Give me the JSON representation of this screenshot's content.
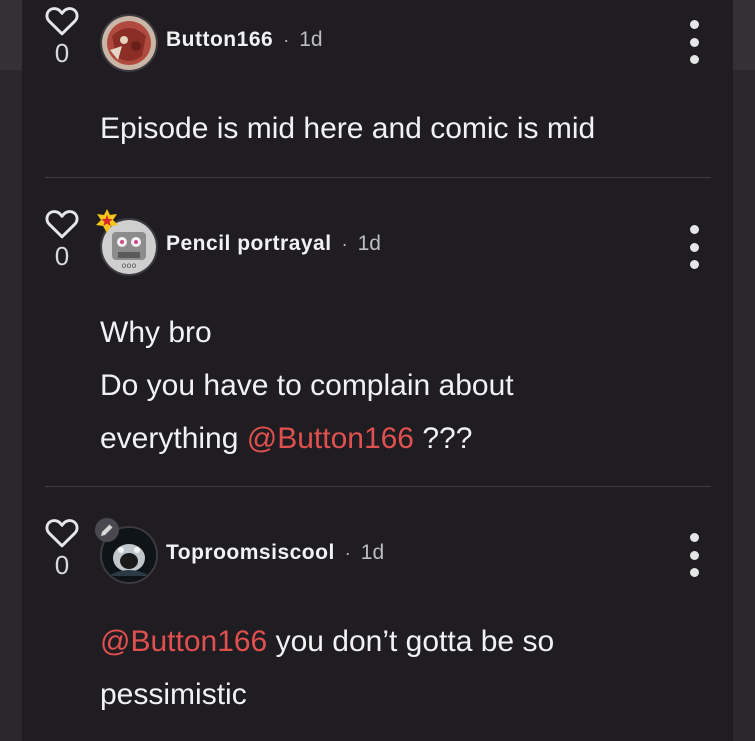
{
  "comments": [
    {
      "likes": "0",
      "username": "Button166",
      "time": "1d",
      "text_lines": [
        "Episode is mid here and comic is mid"
      ],
      "avatar_icon": "avatar-button166-icon",
      "badge": null
    },
    {
      "likes": "0",
      "username": "Pencil portrayal",
      "time": "1d",
      "line1": "Why bro",
      "line2": "Do you have to complain about",
      "line3_prefix": "everything ",
      "line3_mention": "@Button166",
      "line3_suffix": " ???",
      "avatar_icon": "avatar-pencil-portrayal-icon",
      "badge": "star-badge-icon"
    },
    {
      "likes": "0",
      "username": "Toproomsiscool",
      "time": "1d",
      "line1_mention": "@Button166",
      "line1_suffix": " you don’t gotta be so",
      "line2": "pessimistic",
      "avatar_icon": "avatar-toproomsiscool-icon",
      "badge": "pencil-badge-icon"
    }
  ],
  "separator": "·",
  "colors": {
    "background": "#1f1d22",
    "mention": "#e0504e",
    "text": "#f2f2f2",
    "muted": "#bdbdbd",
    "badge_gold": "#f5c518"
  }
}
